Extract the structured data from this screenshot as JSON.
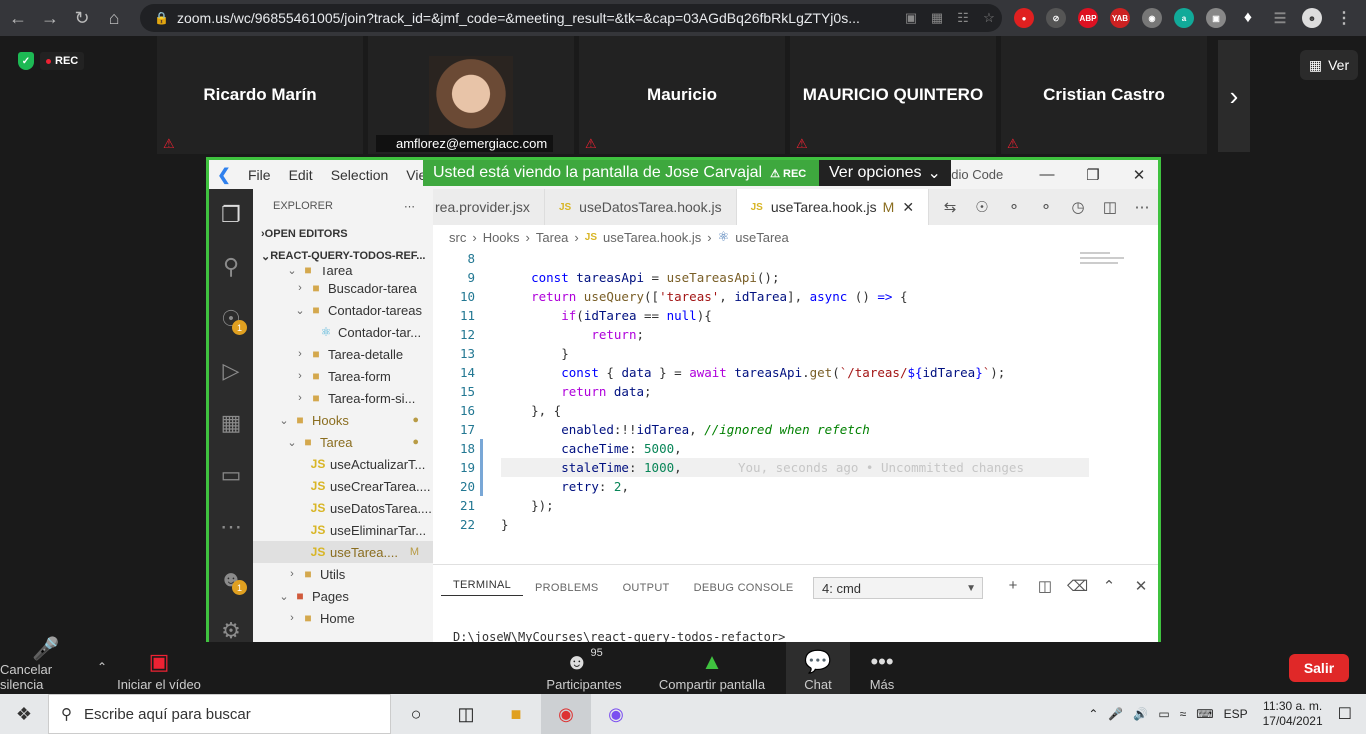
{
  "browser": {
    "url": "zoom.us/wc/96855461005/join?track_id=&jmf_code=&meeting_result=&tk=&cap=03AGdBq26fbRkLgZTYj0s..."
  },
  "participants": [
    {
      "name": "Ricardo Marín"
    },
    {
      "name": "amflorez@emergiacc.com"
    },
    {
      "name": "Mauricio"
    },
    {
      "name": "MAURICIO QUINTERO"
    },
    {
      "name": "Cristian Castro"
    }
  ],
  "top_controls": {
    "rec_label": "REC",
    "ver_label": "Ver"
  },
  "share": {
    "banner": "Usted está viendo la pantalla de Jose Carvajal",
    "banner_rec": "REC",
    "options_label": "Ver opciones"
  },
  "vscode": {
    "menu": [
      "File",
      "Edit",
      "Selection",
      "View"
    ],
    "app_title": "udio Code",
    "explorer_label": "EXPLORER",
    "open_editors": "OPEN EDITORS",
    "project": "REACT-QUERY-TODOS-REF...",
    "tree": [
      {
        "label": "Tarea"
      },
      {
        "label": "Buscador-tarea"
      },
      {
        "label": "Contador-tareas"
      },
      {
        "label": "Contador-tar..."
      },
      {
        "label": "Tarea-detalle"
      },
      {
        "label": "Tarea-form"
      },
      {
        "label": "Tarea-form-si..."
      },
      {
        "label": "Hooks"
      },
      {
        "label": "Tarea"
      },
      {
        "label": "useActualizarT..."
      },
      {
        "label": "useCrearTarea...."
      },
      {
        "label": "useDatosTarea...."
      },
      {
        "label": "useEliminarTar..."
      },
      {
        "label": "useTarea....",
        "mark": "M"
      },
      {
        "label": "Utils"
      },
      {
        "label": "Pages"
      },
      {
        "label": "Home"
      }
    ],
    "tabs": [
      {
        "label": "rea.provider.jsx"
      },
      {
        "label": "useDatosTarea.hook.js"
      },
      {
        "label": "useTarea.hook.js",
        "mark": "M"
      }
    ],
    "js_badge": "JS",
    "breadcrumb": [
      "src",
      "Hooks",
      "Tarea",
      "useTarea.hook.js",
      "useTarea"
    ],
    "line_numbers": [
      "8",
      "9",
      "10",
      "11",
      "12",
      "13",
      "14",
      "15",
      "16",
      "17",
      "18",
      "19",
      "20",
      "21",
      "22"
    ],
    "blame": "You, seconds ago • Uncommitted changes",
    "terminal_tabs": [
      "TERMINAL",
      "PROBLEMS",
      "OUTPUT",
      "DEBUG CONSOLE"
    ],
    "terminal_select": "4: cmd",
    "terminal_prompt": "D:\\joseW\\MyCourses\\react-query-todos-refactor>"
  },
  "zoom_bar": {
    "mute": "Cancelar silencia",
    "video": "Iniciar el vídeo",
    "participants": "Participantes",
    "participants_count": "95",
    "share": "Compartir pantalla",
    "chat": "Chat",
    "more": "Más",
    "leave": "Salir"
  },
  "taskbar": {
    "search_placeholder": "Escribe aquí para buscar",
    "lang": "ESP",
    "time": "11:30 a. m.",
    "date": "17/04/2021"
  },
  "colors": {
    "share_border": "#3fc23f",
    "leave": "#e02828",
    "banner": "#3ea83e"
  }
}
